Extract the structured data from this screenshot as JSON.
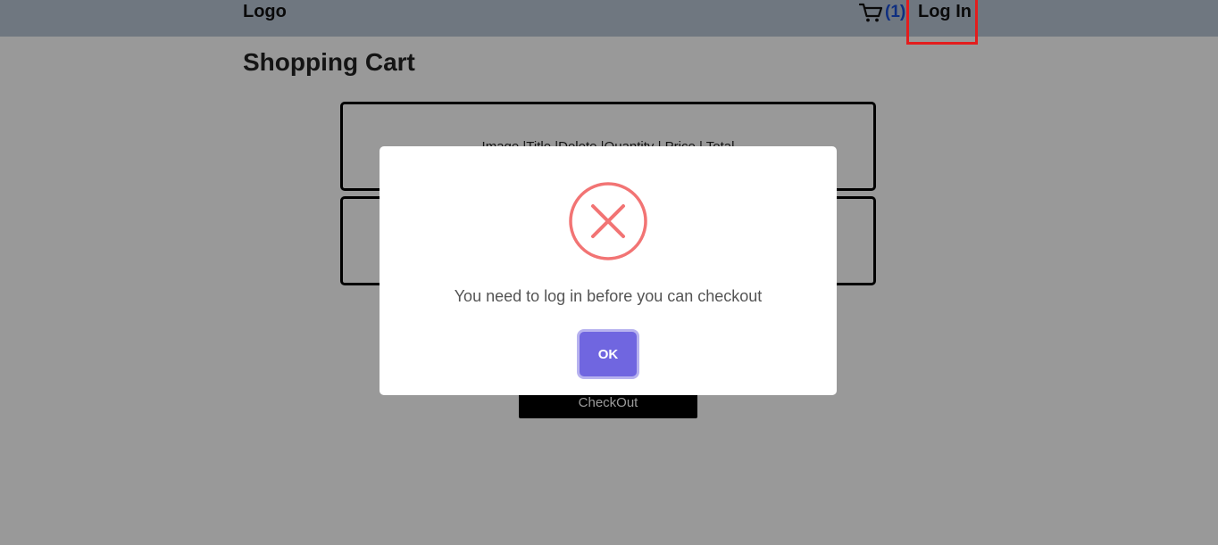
{
  "navbar": {
    "logo": "Logo",
    "cart_count": "(1)",
    "login_label": "Log In"
  },
  "page": {
    "title": "Shopping Cart",
    "cart_header": "Image |Title |Delete |Quantity | Price | Total",
    "checkout_label": "CheckOut"
  },
  "modal": {
    "message": "You need to log in before you can checkout",
    "ok_label": "OK"
  },
  "colors": {
    "navbar_bg": "#b9c6d6",
    "error_icon": "#f27474",
    "ok_button": "#7066e0",
    "cart_count": "#1a4fd6",
    "highlight": "#e31d1d"
  },
  "icons": {
    "cart": "cart-icon",
    "error": "error-x-circle-icon"
  }
}
